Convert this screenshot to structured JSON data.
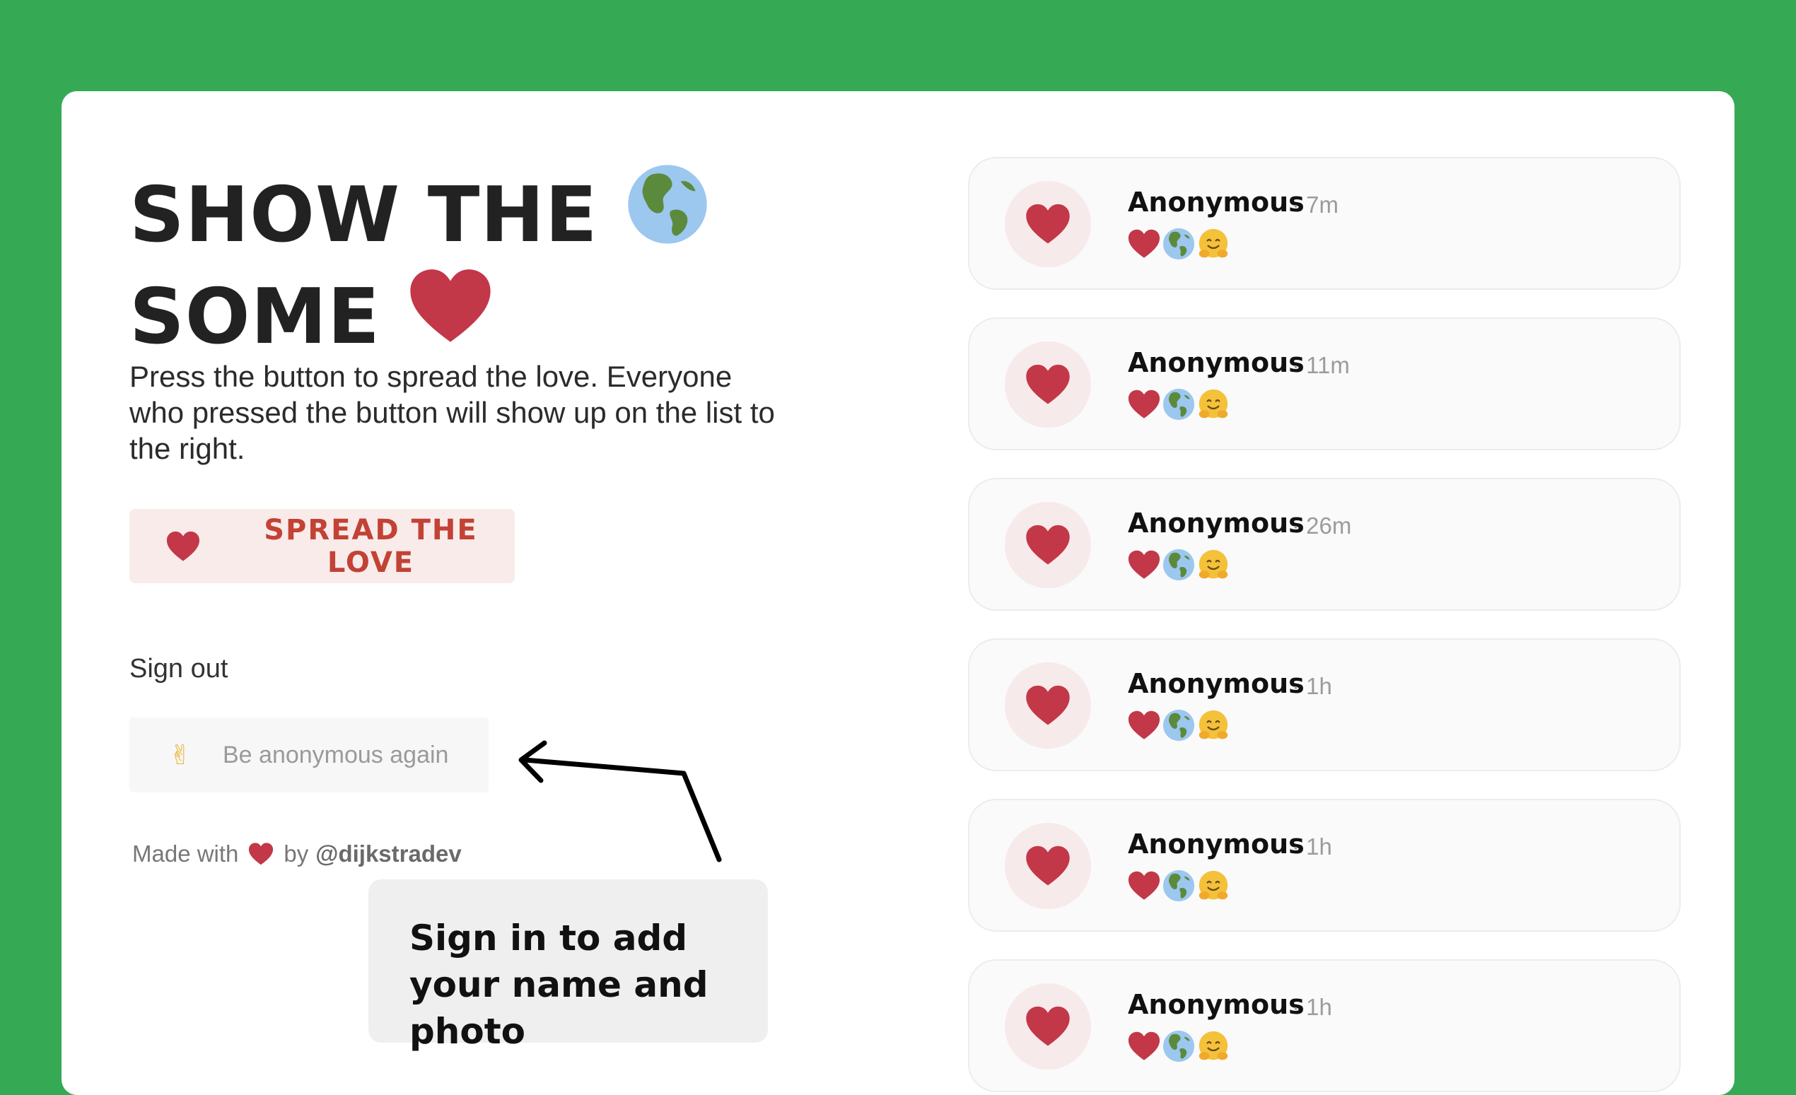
{
  "title": {
    "line1": "SHOW THE",
    "line2": "SOME"
  },
  "description": "Press the button to spread the love. Everyone who pressed the button will show up on the list to the right.",
  "spread_button": {
    "label": "SPREAD THE LOVE"
  },
  "sign_out": {
    "label": "Sign out"
  },
  "anonymous_button": {
    "icon": "victory-hand-icon",
    "emoji": "✌",
    "label": "Be anonymous again"
  },
  "footer": {
    "made_with": "Made with",
    "by": "by",
    "author": "@dijkstradev"
  },
  "callout": {
    "text": "Sign in to add your name and photo"
  },
  "colors": {
    "background": "#36a955",
    "heart": "#c23848",
    "spread_text": "#c24235",
    "spread_bg": "#f8ebea"
  },
  "feed": [
    {
      "name": "Anonymous",
      "time": "· 7m"
    },
    {
      "name": "Anonymous",
      "time": "· 11m"
    },
    {
      "name": "Anonymous",
      "time": "· 26m"
    },
    {
      "name": "Anonymous",
      "time": "· 1h"
    },
    {
      "name": "Anonymous",
      "time": "· 1h"
    },
    {
      "name": "Anonymous",
      "time": "· 1h"
    }
  ]
}
